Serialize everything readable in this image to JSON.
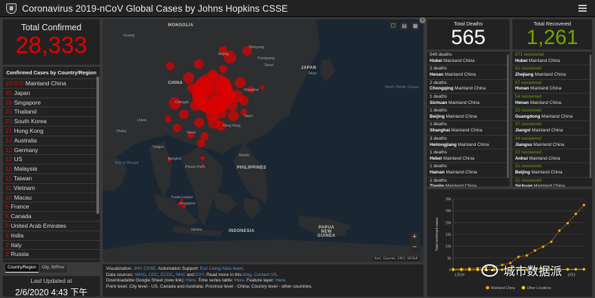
{
  "header": {
    "title": "Coronavirus 2019-nCoV Global Cases by Johns Hopkins CSSE"
  },
  "total_confirmed": {
    "label": "Total Confirmed",
    "value": "28,333"
  },
  "country_list": {
    "header": "Confirmed Cases by Country/Region",
    "rows": [
      {
        "count": "28,076",
        "name": "Mainland China"
      },
      {
        "count": "45",
        "name": "Japan"
      },
      {
        "count": "28",
        "name": "Singapore"
      },
      {
        "count": "25",
        "name": "Thailand"
      },
      {
        "count": "23",
        "name": "South Korea"
      },
      {
        "count": "21",
        "name": "Hong Kong"
      },
      {
        "count": "14",
        "name": "Australia"
      },
      {
        "count": "12",
        "name": "Germany"
      },
      {
        "count": "12",
        "name": "US"
      },
      {
        "count": "12",
        "name": "Malaysia"
      },
      {
        "count": "11",
        "name": "Taiwan"
      },
      {
        "count": "11",
        "name": "Vietnam"
      },
      {
        "count": "10",
        "name": "Macau"
      },
      {
        "count": "6",
        "name": "France"
      },
      {
        "count": "5",
        "name": "Canada"
      },
      {
        "count": "5",
        "name": "United Arab Emirates"
      },
      {
        "count": "3",
        "name": "India"
      },
      {
        "count": "2",
        "name": "Italy"
      },
      {
        "count": "2",
        "name": "Russia"
      }
    ],
    "tabs": [
      "Country/Region",
      "City, St/Prov"
    ]
  },
  "last_updated": {
    "label": "Last Updated at",
    "value": "2/6/2020 4:43 下午"
  },
  "map": {
    "labels": {
      "mongolia": "MONGOLIA",
      "china": "CHINA",
      "japan": "JAPAN",
      "indonesia": "INDONESIA",
      "philippines": "PHILIPPINES",
      "papua": "PAPUA NEW GUINEA",
      "north_pacific": "North Pacific Ocean",
      "bay_bengal": "Bay of Bengal",
      "urumqi": "Urumqi",
      "beijing": "Beijing",
      "shenyang": "Shenyang",
      "pyongyang": "Pyongyang",
      "seoul": "Seoul",
      "tokyo": "Tokyo",
      "shanghai": "Shanghai",
      "chengdu": "Chengdu",
      "hong_kong": "Hong Kong",
      "taipei": "Taipei",
      "hanoi": "Hanoi",
      "yangon": "Yangon",
      "bangkok": "Bangkok",
      "manila": "Manila",
      "phnom_penh": "Phnom Penh",
      "kuala_lumpur": "Kuala Lumpur",
      "singapore": "Singapore",
      "jakarta": "Jakarta",
      "dhaka": "Dhaka",
      "lhasa": "Lhasa"
    },
    "attribution": "Esri, Garmin, FAO, NOAA",
    "zoom_in": "+",
    "zoom_out": "−",
    "tools": [
      "☐",
      "▤",
      "▦"
    ],
    "close": "×"
  },
  "sources": {
    "line1_a": "Visualization: ",
    "line1_jhu": "JHU CSSE",
    "line1_b": ". Automation Support: ",
    "line1_esri": "Esri Living Atlas team",
    "line1_c": ".",
    "line2_a": "Data sources: ",
    "who": "WHO",
    "cdc": "CDC",
    "ecdc": "ECDC",
    "nhc": "NHC",
    "dxy": "DXY",
    "line2_b": ". Read more in this ",
    "blog": "blog",
    "contact": "Contact US",
    "line3_a": "Downloadable Google Sheet (new link): ",
    "here1": "Here",
    "line3_b": ". Time series table: ",
    "here2": "Here",
    "line3_c": ". Feature layer: ",
    "here3": "Here",
    "line3_d": ".",
    "line4": "Point level: City level - US, Canada and Australia; Province level - China; Country level - other countries."
  },
  "total_deaths": {
    "label": "Total Deaths",
    "value": "565"
  },
  "deaths_list": [
    {
      "count": "549 deaths",
      "place": "Hubei",
      "region": "Mainland China"
    },
    {
      "count": "2 deaths",
      "place": "Henan",
      "region": "Mainland China"
    },
    {
      "count": "2 deaths",
      "place": "Chongqing",
      "region": "Mainland China"
    },
    {
      "count": "1 deaths",
      "place": "Sichuan",
      "region": "Mainland China"
    },
    {
      "count": "1 deaths",
      "place": "Beijing",
      "region": "Mainland China"
    },
    {
      "count": "1 deaths",
      "place": "Shanghai",
      "region": "Mainland China"
    },
    {
      "count": "3 deaths",
      "place": "Heilongjiang",
      "region": "Mainland China"
    },
    {
      "count": "1 deaths",
      "place": "Hebei",
      "region": "Mainland China"
    },
    {
      "count": "1 deaths",
      "place": "Hainan",
      "region": "Mainland China"
    },
    {
      "count": "1 deaths",
      "place": "Tianjin",
      "region": "Mainland China"
    }
  ],
  "total_recovered": {
    "label": "Total Recovered",
    "value": "1,261"
  },
  "recovered_list": [
    {
      "count": "671 recovered",
      "place": "Hubei",
      "region": "Mainland China"
    },
    {
      "count": "81 recovered",
      "place": "Zhejiang",
      "region": "Mainland China"
    },
    {
      "count": "67 recovered",
      "place": "Hunan",
      "region": "Mainland China"
    },
    {
      "count": "54 recovered",
      "place": "Henan",
      "region": "Mainland China"
    },
    {
      "count": "52 recovered",
      "place": "Guangdong",
      "region": "Mainland China"
    },
    {
      "count": "37 recovered",
      "place": "Jiangxi",
      "region": "Mainland China"
    },
    {
      "count": "34 recovered",
      "place": "Jiangsu",
      "region": "Mainland China"
    },
    {
      "count": "32 recovered",
      "place": "Anhui",
      "region": "Mainland China"
    },
    {
      "count": "31 recovered",
      "place": "Beijing",
      "region": "Mainland China"
    },
    {
      "count": "31 recovered",
      "place": "Sichuan",
      "region": "Mainland China"
    }
  ],
  "chart_data": {
    "type": "line",
    "ylabel": "Total confirmed cases",
    "ylim": [
      0,
      30000
    ],
    "yticks": [
      "0",
      "5k",
      "10k",
      "15k",
      "20k",
      "25k",
      "30k"
    ],
    "xticks": [
      "1月20",
      "2月3"
    ],
    "xlim": [
      0,
      16
    ],
    "series": [
      {
        "name": "Mainland China",
        "color": "#f7a31e",
        "values": [
          278,
          326,
          547,
          639,
          916,
          1399,
          2062,
          2863,
          5494,
          6070,
          8124,
          9783,
          11871,
          16607,
          19693,
          23680,
          27409
        ]
      },
      {
        "name": "Other Locations",
        "color": "#ffd700",
        "values": [
          4,
          6,
          8,
          14,
          25,
          40,
          57,
          64,
          87,
          105,
          118,
          153,
          173,
          183,
          188,
          212,
          227
        ]
      }
    ],
    "legend": "bottom"
  },
  "watermark": {
    "text": "城市数据派"
  },
  "colors": {
    "red": "#e60000",
    "green": "#70a800",
    "link": "#4d9ee8"
  }
}
